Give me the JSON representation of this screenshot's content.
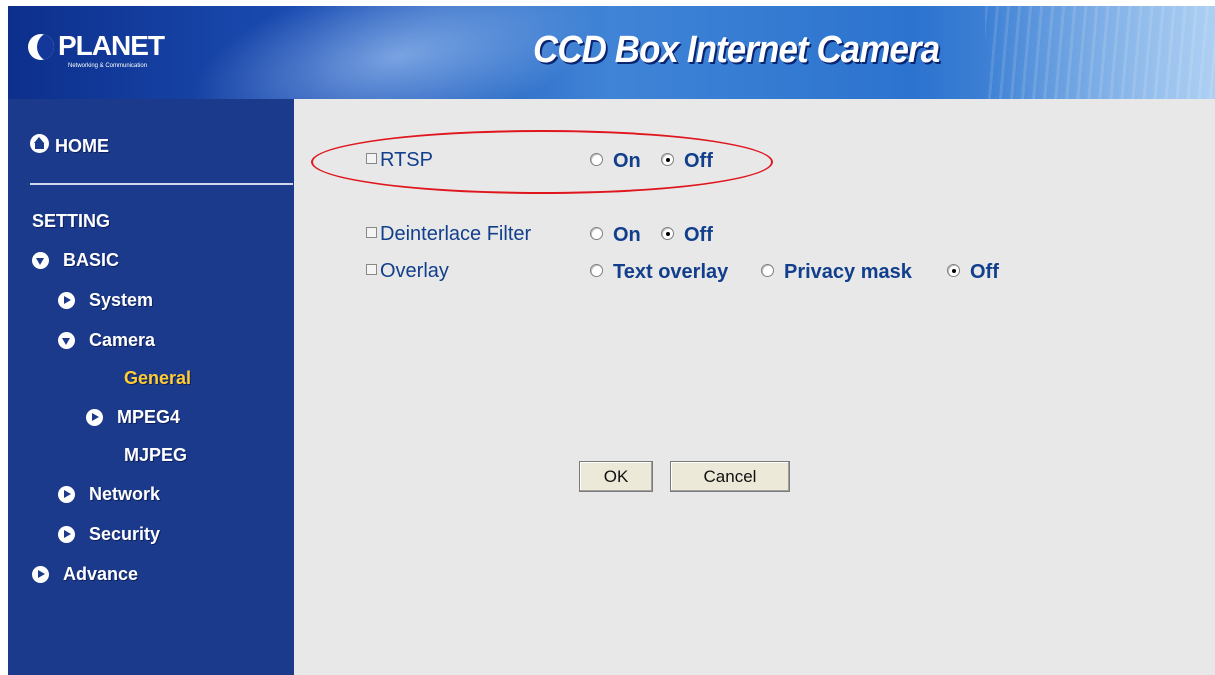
{
  "header": {
    "logo_text": "PLANET",
    "logo_subtitle": "Networking & Communication",
    "title": "CCD Box Internet Camera"
  },
  "sidebar": {
    "home": "HOME",
    "setting": "SETTING",
    "basic": "BASIC",
    "system": "System",
    "camera": "Camera",
    "general": "General",
    "mpeg4": "MPEG4",
    "mjpeg": "MJPEG",
    "network": "Network",
    "security": "Security",
    "advance": "Advance",
    "active_item": "General",
    "active_color": "#ffcc33"
  },
  "form": {
    "rtsp": {
      "label": "RTSP",
      "options": [
        "On",
        "Off"
      ],
      "selected": "Off"
    },
    "deinterlace": {
      "label": "Deinterlace Filter",
      "options": [
        "On",
        "Off"
      ],
      "selected": "Off"
    },
    "overlay": {
      "label": "Overlay",
      "options": [
        "Text overlay",
        "Privacy mask",
        "Off"
      ],
      "selected": "Off"
    },
    "highlight_color": "#e0161e"
  },
  "buttons": {
    "ok": "OK",
    "cancel": "Cancel"
  }
}
